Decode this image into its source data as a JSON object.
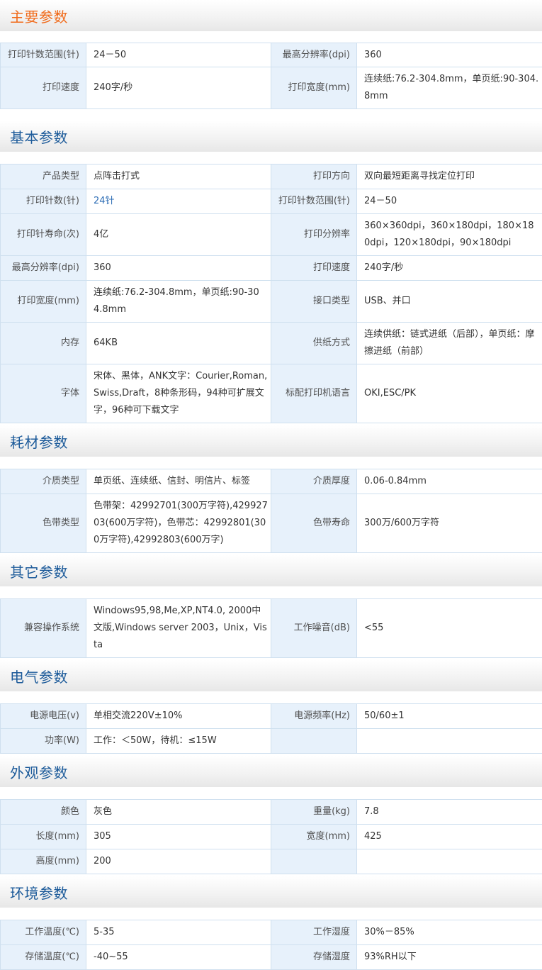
{
  "colors": {
    "section_title": "#1d5b9a",
    "section_title_first": "#f06a1a",
    "label_bg": "#e7f1fb",
    "border": "#cfe0ef"
  },
  "sections": [
    {
      "title": "主要参数",
      "rows": [
        [
          "打印针数范围(针)",
          "24－50",
          "最高分辨率(dpi)",
          "360"
        ],
        [
          "打印速度",
          "240字/秒",
          "打印宽度(mm)",
          "连续纸:76.2-304.8mm，单页纸:90-304.8mm"
        ]
      ]
    },
    {
      "title": "基本参数",
      "rows": [
        [
          "产品类型",
          "点阵击打式",
          "打印方向",
          "双向最短距离寻找定位打印"
        ],
        [
          "打印针数(针)",
          "24针",
          "打印针数范围(针)",
          "24－50"
        ],
        [
          "打印针寿命(次)",
          "4亿",
          "打印分辨率",
          "360×360dpi，360×180dpi，180×180dpi，120×180dpi，90×180dpi"
        ],
        [
          "最高分辨率(dpi)",
          "360",
          "打印速度",
          "240字/秒"
        ],
        [
          "打印宽度(mm)",
          "连续纸:76.2-304.8mm，单页纸:90-304.8mm",
          "接口类型",
          "USB、并口"
        ],
        [
          "内存",
          "64KB",
          "供纸方式",
          "连续供纸：链式进纸（后部），单页纸：摩擦进纸（前部）"
        ],
        [
          "字体",
          "宋体、黑体，ANK文字：Courier,Roman,Swiss,Draft，8种条形码，94种可扩展文字，96种可下载文字",
          "标配打印机语言",
          "OKI,ESC/PK"
        ]
      ]
    },
    {
      "title": "耗材参数",
      "rows": [
        [
          "介质类型",
          "单页纸、连续纸、信封、明信片、标签",
          "介质厚度",
          "0.06-0.84mm"
        ],
        [
          "色带类型",
          "色带架：42992701(300万字符),42992703(600万字符)，色带芯：42992801(300万字符),42992803(600万字)",
          "色带寿命",
          "300万/600万字符"
        ]
      ]
    },
    {
      "title": "其它参数",
      "rows": [
        [
          "兼容操作系统",
          "Windows95,98,Me,XP,NT4.0, 2000中文版,Windows server 2003，Unix，Vista",
          "工作噪音(dB)",
          "<55"
        ]
      ]
    },
    {
      "title": "电气参数",
      "rows": [
        [
          "电源电压(v)",
          "单相交流220V±10%",
          "电源频率(Hz)",
          "50/60±1"
        ],
        [
          "功率(W)",
          "工作：＜50W，待机：≤15W",
          "",
          ""
        ]
      ]
    },
    {
      "title": "外观参数",
      "rows": [
        [
          "颜色",
          "灰色",
          "重量(kg)",
          "7.8"
        ],
        [
          "长度(mm)",
          "305",
          "宽度(mm)",
          "425"
        ],
        [
          "高度(mm)",
          "200",
          "",
          ""
        ]
      ]
    },
    {
      "title": "环境参数",
      "rows": [
        [
          "工作温度(℃)",
          "5-35",
          "工作湿度",
          "30%－85%"
        ],
        [
          "存储温度(℃)",
          "-40~55",
          "存储湿度",
          "93%RH以下"
        ]
      ]
    }
  ]
}
